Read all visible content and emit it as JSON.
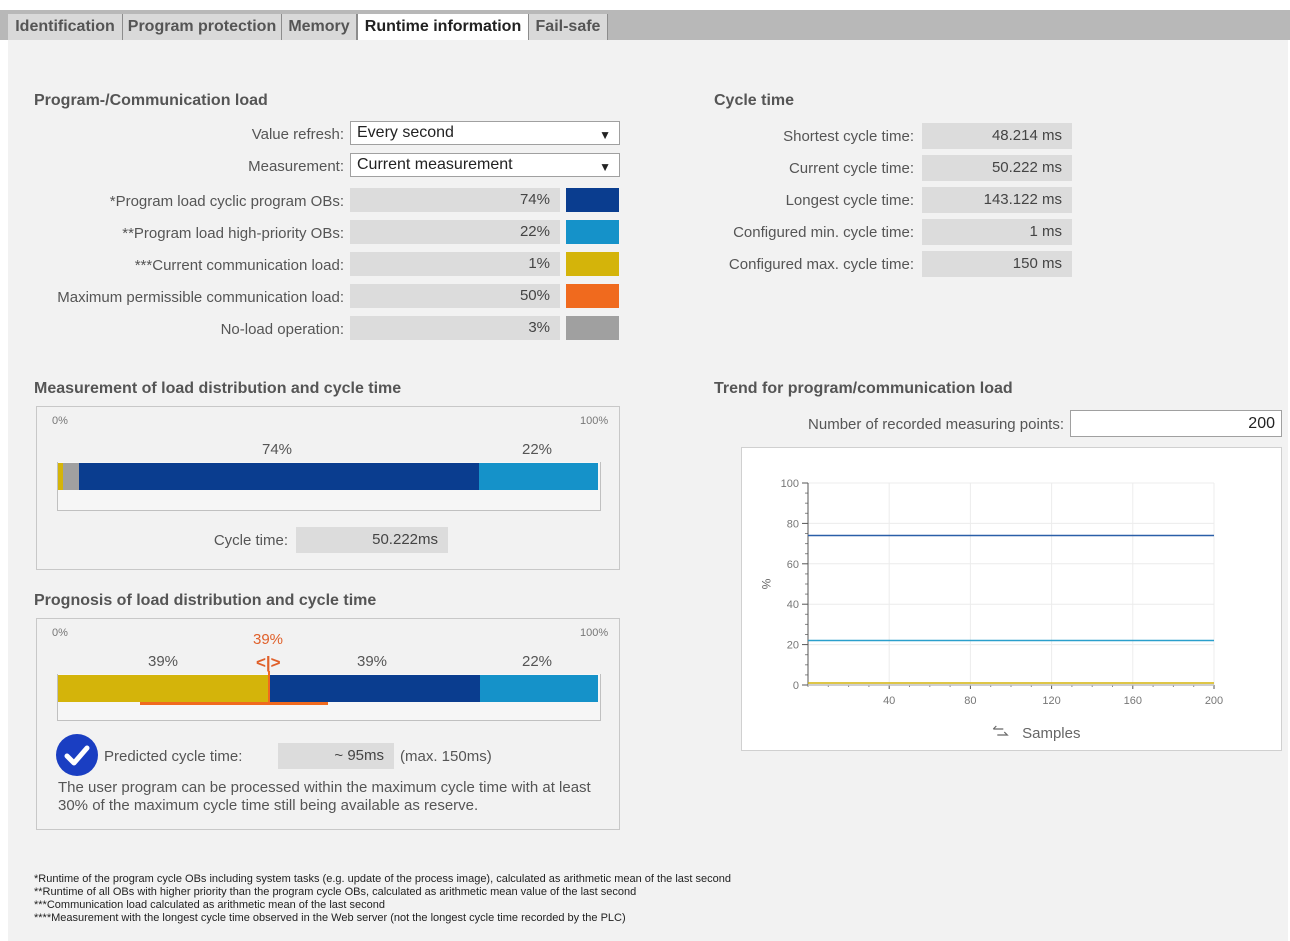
{
  "tabs": [
    {
      "label": "Identification",
      "active": false
    },
    {
      "label": "Program protection",
      "active": false
    },
    {
      "label": "Memory",
      "active": false
    },
    {
      "label": "Runtime information",
      "active": true
    },
    {
      "label": "Fail-safe",
      "active": false
    }
  ],
  "load": {
    "title": "Program-/Communication load",
    "value_refresh_label": "Value refresh:",
    "value_refresh": "Every second",
    "measurement_label": "Measurement:",
    "measurement": "Current measurement",
    "rows": [
      {
        "label": "*Program load cyclic program OBs:",
        "value": "74%",
        "color": "#0a3d8f"
      },
      {
        "label": "**Program load high-priority OBs:",
        "value": "22%",
        "color": "#1592c9"
      },
      {
        "label": "***Current communication load:",
        "value": "1%",
        "color": "#d4b40a"
      },
      {
        "label": "Maximum permissible communication load:",
        "value": "50%",
        "color": "#f06a1e"
      },
      {
        "label": "No-load operation:",
        "value": "3%",
        "color": "#a0a0a0"
      }
    ]
  },
  "cycle": {
    "title": "Cycle time",
    "rows": [
      {
        "label": "Shortest cycle time:",
        "value": "48.214 ms"
      },
      {
        "label": "Current cycle time:",
        "value": "50.222 ms"
      },
      {
        "label": "Longest cycle time:",
        "value": "143.122 ms"
      },
      {
        "label": "Configured min. cycle time:",
        "value": "1 ms"
      },
      {
        "label": "Configured max. cycle time:",
        "value": "150 ms"
      }
    ]
  },
  "measurement": {
    "title": "Measurement of load distribution and cycle time",
    "min_label": "0%",
    "max_label": "100%",
    "main_pct": "74%",
    "high_pct": "22%",
    "cycle_label": "Cycle time:",
    "cycle_value": "50.222ms",
    "segments": [
      {
        "name": "comm",
        "fraction": 0.01,
        "color": "#d4b40a"
      },
      {
        "name": "noload",
        "fraction": 0.03,
        "color": "#a0a0a0"
      },
      {
        "name": "cyclic",
        "fraction": 0.74,
        "color": "#0a3d8f"
      },
      {
        "name": "highprio",
        "fraction": 0.22,
        "color": "#1592c9"
      }
    ]
  },
  "prognosis": {
    "title": "Prognosis of load distribution and cycle time",
    "min_label": "0%",
    "max_label": "100%",
    "marker_pct": "39%",
    "marker_arrows": "<|>",
    "seg1_pct": "39%",
    "seg2_pct": "39%",
    "seg3_pct": "22%",
    "predicted_label": "Predicted cycle time:",
    "predicted_value": "~ 95ms",
    "predicted_max": "(max. 150ms)",
    "message": "The user program can be processed within the maximum cycle time with at least 30% of the maximum cycle time still being available as reserve.",
    "segments": [
      {
        "name": "yellow",
        "fraction": 0.39,
        "color": "#d4b40a"
      },
      {
        "name": "dark",
        "fraction": 0.39,
        "color": "#0a3d8f"
      },
      {
        "name": "light",
        "fraction": 0.22,
        "color": "#1592c9"
      }
    ],
    "marker_fraction": 0.39
  },
  "trend": {
    "title": "Trend for program/communication load",
    "points_label": "Number of recorded measuring points:",
    "points_value": "200",
    "xlabel": "Samples",
    "ylabel": "%"
  },
  "chart_data": {
    "type": "line",
    "x_range": [
      0,
      200
    ],
    "ylim": [
      0,
      100
    ],
    "x_ticks": [
      40,
      80,
      120,
      160,
      200
    ],
    "y_ticks": [
      0,
      20,
      40,
      60,
      80,
      100
    ],
    "series": [
      {
        "color": "#2a5fa8",
        "points": [
          [
            0,
            74
          ],
          [
            200,
            74
          ]
        ]
      },
      {
        "color": "#2a9fcc",
        "points": [
          [
            0,
            22
          ],
          [
            200,
            22
          ]
        ]
      },
      {
        "color": "#d4b40a",
        "points": [
          [
            0,
            1
          ],
          [
            200,
            1
          ]
        ]
      },
      {
        "color": "#bdbdbd",
        "points": [
          [
            0,
            0
          ],
          [
            200,
            0
          ]
        ]
      }
    ],
    "xlabel": "Samples",
    "ylabel": "%"
  },
  "footnotes": [
    "*Runtime of the program cycle OBs including system tasks (e.g. update of the process image), calculated as arithmetic mean of the last second",
    "**Runtime of all OBs with higher priority than the program cycle OBs, calculated as arithmetic mean value of the last second",
    "***Communication load calculated as arithmetic mean of the last second",
    "****Measurement with the longest cycle time observed in the Web server (not the longest cycle time recorded by the PLC)"
  ]
}
